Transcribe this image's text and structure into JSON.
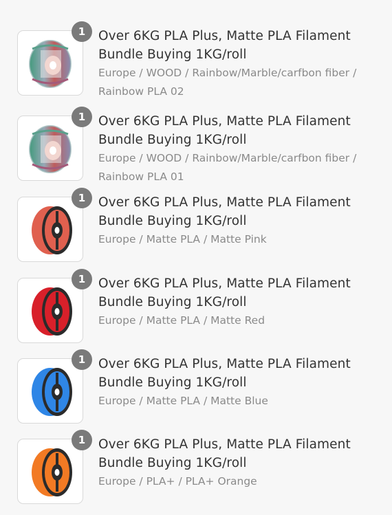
{
  "order": {
    "items": [
      {
        "quantity": "1",
        "title": "Over 6KG PLA Plus, Matte PLA Filament Bundle Buying 1KG/roll",
        "variant": "Europe / WOOD / Rainbow/Marble/carfbon fiber / Rainbow PLA 02",
        "image": "rainbow-filament-spool",
        "spool_colors": [
          "#2f8f6f",
          "#b74a4a",
          "#7a7fa6"
        ]
      },
      {
        "quantity": "1",
        "title": "Over 6KG PLA Plus, Matte PLA Filament Bundle Buying 1KG/roll",
        "variant": "Europe / WOOD / Rainbow/Marble/carfbon fiber / Rainbow PLA 01",
        "image": "rainbow-filament-spool",
        "spool_colors": [
          "#2f8f6f",
          "#b74a4a",
          "#7a7fa6"
        ]
      },
      {
        "quantity": "1",
        "title": "Over 6KG PLA Plus, Matte PLA Filament Bundle Buying 1KG/roll",
        "variant": "Europe / Matte PLA / Matte Pink",
        "image": "pink-filament-spool",
        "spool_colors": [
          "#e0604f"
        ]
      },
      {
        "quantity": "1",
        "title": "Over 6KG PLA Plus, Matte PLA Filament Bundle Buying 1KG/roll",
        "variant": "Europe / Matte PLA / Matte Red",
        "image": "red-filament-spool",
        "spool_colors": [
          "#d8202a"
        ]
      },
      {
        "quantity": "1",
        "title": "Over 6KG PLA Plus, Matte PLA Filament Bundle Buying 1KG/roll",
        "variant": "Europe / Matte PLA / Matte Blue",
        "image": "blue-filament-spool",
        "spool_colors": [
          "#2f86e6"
        ]
      },
      {
        "quantity": "1",
        "title": "Over 6KG PLA Plus, Matte PLA Filament Bundle Buying 1KG/roll",
        "variant": "Europe / PLA+ / PLA+ Orange",
        "image": "orange-filament-spool",
        "spool_colors": [
          "#f27a24"
        ]
      }
    ]
  },
  "theme": {
    "background": "#f7f7f7",
    "badge": "#7a7a7a",
    "title_text": "#333333",
    "variant_text": "#8a8a8a",
    "spool_hub": "#2b2b2b"
  }
}
